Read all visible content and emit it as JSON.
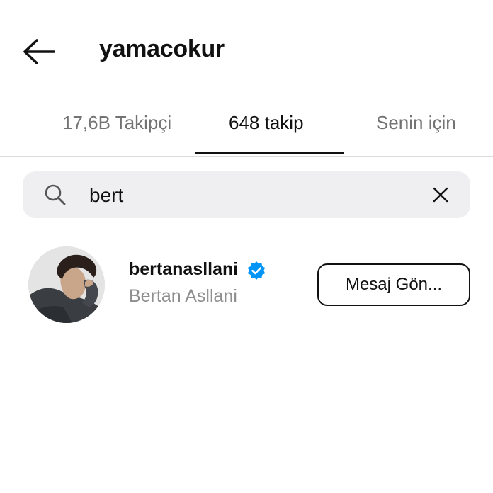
{
  "header": {
    "title": "yamacokur",
    "back_icon": "arrow-left-icon"
  },
  "tabs": [
    {
      "label": "17,6B Takipçi",
      "active": false
    },
    {
      "label": "648 takip",
      "active": true
    },
    {
      "label": "Senin için",
      "active": false
    }
  ],
  "search": {
    "value": "bert",
    "search_icon": "search-icon",
    "clear_icon": "close-icon"
  },
  "results": [
    {
      "username": "bertanasllani",
      "full_name": "Bertan Asllani",
      "verified": true,
      "action_label": "Mesaj Gön..."
    }
  ],
  "colors": {
    "text_primary": "#111111",
    "text_secondary": "#8e8e8e",
    "search_bg": "#efeff1",
    "verified_blue": "#0095f6"
  }
}
